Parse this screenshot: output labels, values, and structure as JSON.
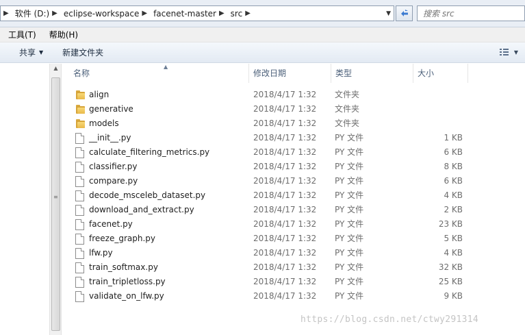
{
  "address_bar": {
    "breadcrumbs": [
      "软件 (D:)",
      "eclipse-workspace",
      "facenet-master",
      "src"
    ]
  },
  "search": {
    "placeholder": "搜索 src"
  },
  "menu": {
    "items": [
      "工具(T)",
      "帮助(H)"
    ]
  },
  "toolbar": {
    "share_label": "共享",
    "new_folder_label": "新建文件夹"
  },
  "columns": {
    "name": "名称",
    "date": "修改日期",
    "type": "类型",
    "size": "大小"
  },
  "files": [
    {
      "name": "align",
      "date": "2018/4/17 1:32",
      "type": "文件夹",
      "size": "",
      "icon": "folder-icon"
    },
    {
      "name": "generative",
      "date": "2018/4/17 1:32",
      "type": "文件夹",
      "size": "",
      "icon": "folder-icon"
    },
    {
      "name": "models",
      "date": "2018/4/17 1:32",
      "type": "文件夹",
      "size": "",
      "icon": "folder-icon"
    },
    {
      "name": "__init__.py",
      "date": "2018/4/17 1:32",
      "type": "PY 文件",
      "size": "1 KB",
      "icon": "file-icon"
    },
    {
      "name": "calculate_filtering_metrics.py",
      "date": "2018/4/17 1:32",
      "type": "PY 文件",
      "size": "6 KB",
      "icon": "file-icon"
    },
    {
      "name": "classifier.py",
      "date": "2018/4/17 1:32",
      "type": "PY 文件",
      "size": "8 KB",
      "icon": "file-icon"
    },
    {
      "name": "compare.py",
      "date": "2018/4/17 1:32",
      "type": "PY 文件",
      "size": "6 KB",
      "icon": "file-icon"
    },
    {
      "name": "decode_msceleb_dataset.py",
      "date": "2018/4/17 1:32",
      "type": "PY 文件",
      "size": "4 KB",
      "icon": "file-icon"
    },
    {
      "name": "download_and_extract.py",
      "date": "2018/4/17 1:32",
      "type": "PY 文件",
      "size": "2 KB",
      "icon": "file-icon"
    },
    {
      "name": "facenet.py",
      "date": "2018/4/17 1:32",
      "type": "PY 文件",
      "size": "23 KB",
      "icon": "file-icon"
    },
    {
      "name": "freeze_graph.py",
      "date": "2018/4/17 1:32",
      "type": "PY 文件",
      "size": "5 KB",
      "icon": "file-icon"
    },
    {
      "name": "lfw.py",
      "date": "2018/4/17 1:32",
      "type": "PY 文件",
      "size": "4 KB",
      "icon": "file-icon"
    },
    {
      "name": "train_softmax.py",
      "date": "2018/4/17 1:32",
      "type": "PY 文件",
      "size": "32 KB",
      "icon": "file-icon"
    },
    {
      "name": "train_tripletloss.py",
      "date": "2018/4/17 1:32",
      "type": "PY 文件",
      "size": "25 KB",
      "icon": "file-icon"
    },
    {
      "name": "validate_on_lfw.py",
      "date": "2018/4/17 1:32",
      "type": "PY 文件",
      "size": "9 KB",
      "icon": "file-icon"
    }
  ],
  "watermark": "https://blog.csdn.net/ctwy291314",
  "colors": {
    "folder": "#e9b94b",
    "toolbar_bg": "#e3eaf3",
    "header_text": "#4c607a"
  }
}
